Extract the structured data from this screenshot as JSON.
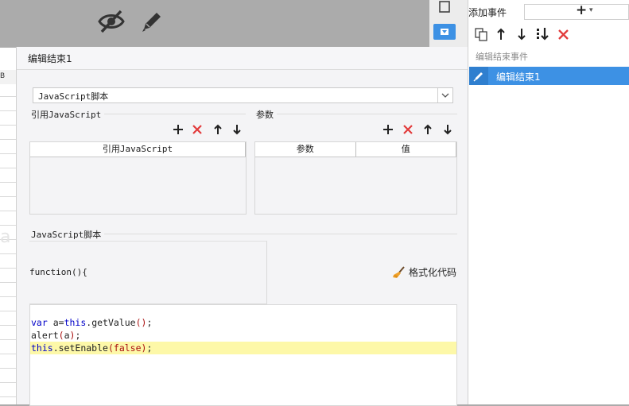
{
  "add_event": {
    "label": "添加事件",
    "dropdown_symbol": "+",
    "caret": "▾"
  },
  "event_list": {
    "header": "编辑结束事件",
    "items": [
      {
        "label": "编辑结束1",
        "icon": "pencil-icon"
      }
    ]
  },
  "grid": {
    "column_header": "B",
    "watermark": "a"
  },
  "dialog": {
    "title": "编辑结束1",
    "script_type_select": "JavaScript脚本",
    "ref_js": {
      "label": "引用JavaScript",
      "column": "引用JavaScript"
    },
    "params": {
      "label": "参数",
      "columns": [
        "参数",
        "值"
      ]
    },
    "script_section": {
      "label": "JavaScript脚本"
    },
    "function_header": "function(){",
    "format_button": "格式化代码",
    "code": {
      "line1": {
        "kw": "var",
        "a": " a=",
        "kw2": "this",
        "b": ".getValue",
        "p": "()",
        "c": ";"
      },
      "line2": {
        "a": "alert",
        "p1": "(",
        "b": "a",
        "p2": ")",
        "c": ";"
      },
      "line3": {
        "kw": "this",
        "a": ".setEnable",
        "p1": "(",
        "kw2": "false",
        "p2": ")",
        "c": ";"
      }
    }
  },
  "colors": {
    "accent": "#3d91e4",
    "delete_red": "#e23b3b",
    "highlight_line": "#fdf8a8",
    "keyword": "#0000c8",
    "paren": "#aa1111"
  }
}
